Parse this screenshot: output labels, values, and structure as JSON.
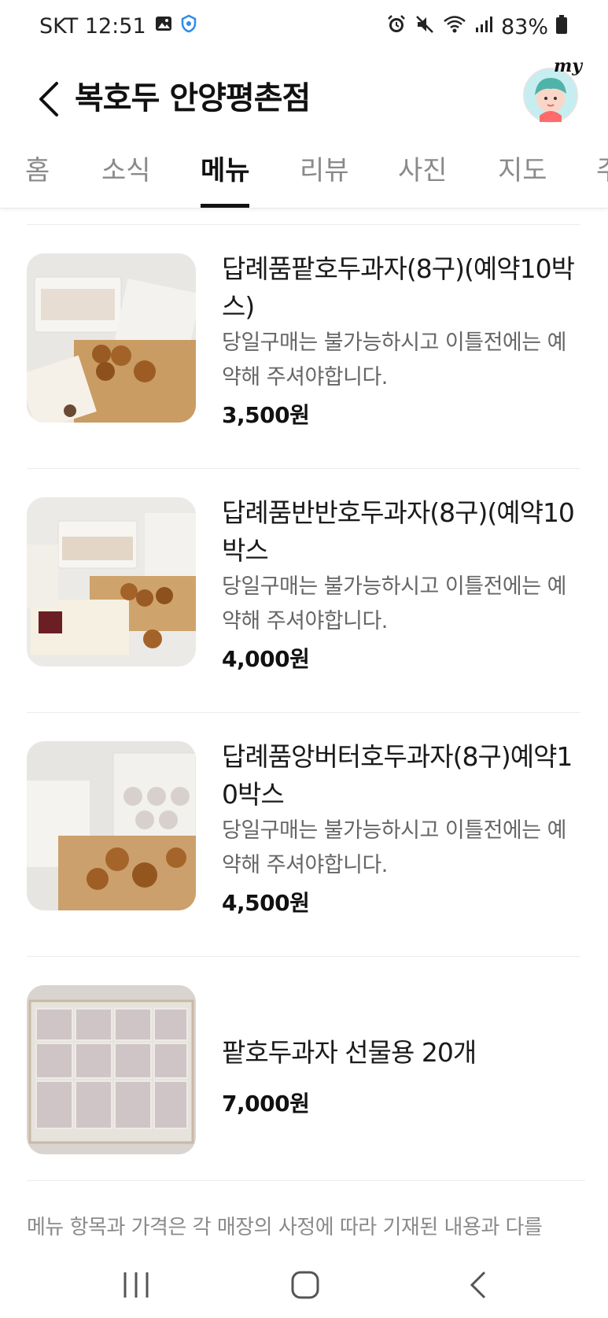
{
  "status_bar": {
    "carrier_time": "SKT 12:51",
    "battery": "83%",
    "icons": [
      "image-icon",
      "shield-icon",
      "alarm-icon",
      "mute-icon",
      "wifi-icon",
      "signal-icon",
      "battery-icon"
    ]
  },
  "header": {
    "title": "복호두 안양평촌점",
    "avatar_label": "my"
  },
  "tabs": [
    {
      "label": "홈"
    },
    {
      "label": "소식"
    },
    {
      "label": "메뉴"
    },
    {
      "label": "리뷰"
    },
    {
      "label": "사진"
    },
    {
      "label": "지도"
    },
    {
      "label": "주"
    }
  ],
  "active_tab": "메뉴",
  "menu_items": [
    {
      "name": "답례품팥호두과자(8구)(예약10박스)",
      "description": "당일구매는 불가능하시고 이틀전에는 예약해 주셔야합니다.",
      "price": "3,500원"
    },
    {
      "name": "답례품반반호두과자(8구)(예약10박스",
      "description": "당일구매는 불가능하시고 이틀전에는 예약해 주셔야합니다.",
      "price": "4,000원"
    },
    {
      "name": "답례품앙버터호두과자(8구)예약10박스",
      "description": "당일구매는 불가능하시고 이틀전에는 예약해 주셔야합니다.",
      "price": "4,500원"
    },
    {
      "name": "팥호두과자 선물용 20개",
      "description": "",
      "price": "7,000원"
    }
  ],
  "notice": "메뉴 항목과 가격은 각 매장의 사정에 따라 기재된 내용과 다를",
  "colors": {
    "text": "#111111",
    "muted": "#8a8a8a",
    "accent_avatar": "#c6eef0"
  }
}
